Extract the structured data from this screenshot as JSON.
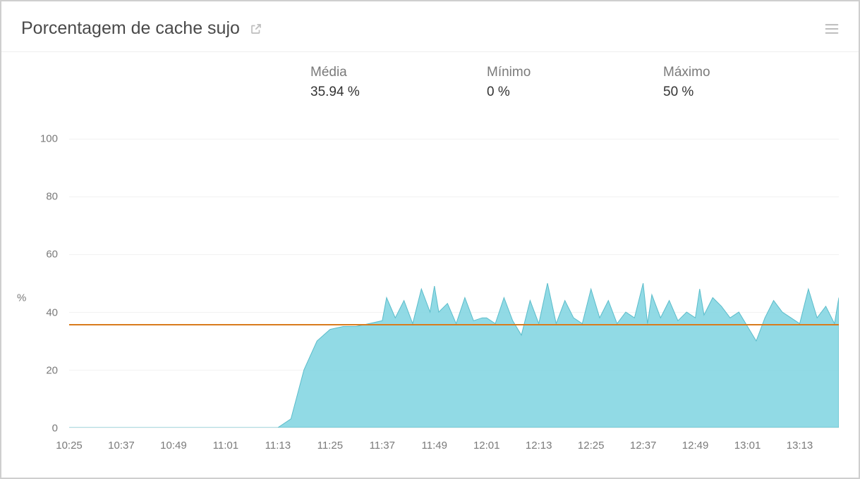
{
  "header": {
    "title": "Porcentagem de cache sujo"
  },
  "stats": {
    "avg_label": "Média",
    "avg_value": "35.94 %",
    "min_label": "Mínimo",
    "min_value": "0 %",
    "max_label": "Máximo",
    "max_value": "50 %"
  },
  "axes": {
    "y_label": "%",
    "y_ticks": [
      "0",
      "20",
      "40",
      "60",
      "80",
      "100"
    ],
    "x_ticks": [
      "10:25",
      "10:37",
      "10:49",
      "11:01",
      "11:13",
      "11:25",
      "11:37",
      "11:49",
      "12:01",
      "12:13",
      "12:25",
      "12:37",
      "12:49",
      "13:01",
      "13:13"
    ]
  },
  "chart_data": {
    "type": "area",
    "title": "Porcentagem de cache sujo",
    "xlabel": "",
    "ylabel": "%",
    "ylim": [
      0,
      100
    ],
    "average": 35.94,
    "minimum": 0,
    "maximum": 50,
    "x": [
      "10:25",
      "10:37",
      "10:49",
      "11:01",
      "11:13",
      "11:16",
      "11:19",
      "11:22",
      "11:25",
      "11:28",
      "11:31",
      "11:34",
      "11:37",
      "11:38",
      "11:40",
      "11:42",
      "11:44",
      "11:46",
      "11:48",
      "11:49",
      "11:50",
      "11:52",
      "11:54",
      "11:56",
      "11:58",
      "12:00",
      "12:01",
      "12:03",
      "12:05",
      "12:07",
      "12:09",
      "12:11",
      "12:13",
      "12:15",
      "12:17",
      "12:19",
      "12:21",
      "12:23",
      "12:25",
      "12:27",
      "12:29",
      "12:31",
      "12:33",
      "12:35",
      "12:37",
      "12:38",
      "12:39",
      "12:41",
      "12:43",
      "12:45",
      "12:47",
      "12:49",
      "12:50",
      "12:51",
      "12:53",
      "12:55",
      "12:57",
      "12:59",
      "13:01",
      "13:03",
      "13:05",
      "13:07",
      "13:09",
      "13:11",
      "13:13",
      "13:15",
      "13:17",
      "13:19",
      "13:21",
      "13:22"
    ],
    "values": [
      0,
      0,
      0,
      0,
      0,
      3,
      20,
      30,
      34,
      35,
      35,
      36,
      37,
      45,
      38,
      44,
      36,
      48,
      40,
      49,
      40,
      43,
      36,
      45,
      37,
      38,
      38,
      36,
      45,
      37,
      32,
      44,
      36,
      50,
      36,
      44,
      38,
      36,
      48,
      38,
      44,
      36,
      40,
      38,
      50,
      36,
      46,
      38,
      44,
      37,
      40,
      38,
      48,
      39,
      45,
      42,
      38,
      40,
      35,
      30,
      38,
      44,
      40,
      38,
      36,
      48,
      38,
      42,
      36,
      45
    ],
    "x_minutes": [
      625,
      637,
      649,
      661,
      673,
      676,
      679,
      682,
      685,
      688,
      691,
      694,
      697,
      698,
      700,
      702,
      704,
      706,
      708,
      709,
      710,
      712,
      714,
      716,
      718,
      720,
      721,
      723,
      725,
      727,
      729,
      731,
      733,
      735,
      737,
      739,
      741,
      743,
      745,
      747,
      749,
      751,
      753,
      755,
      757,
      758,
      759,
      761,
      763,
      765,
      767,
      769,
      770,
      771,
      773,
      775,
      777,
      779,
      781,
      783,
      785,
      787,
      789,
      791,
      793,
      795,
      797,
      799,
      801,
      802
    ]
  }
}
